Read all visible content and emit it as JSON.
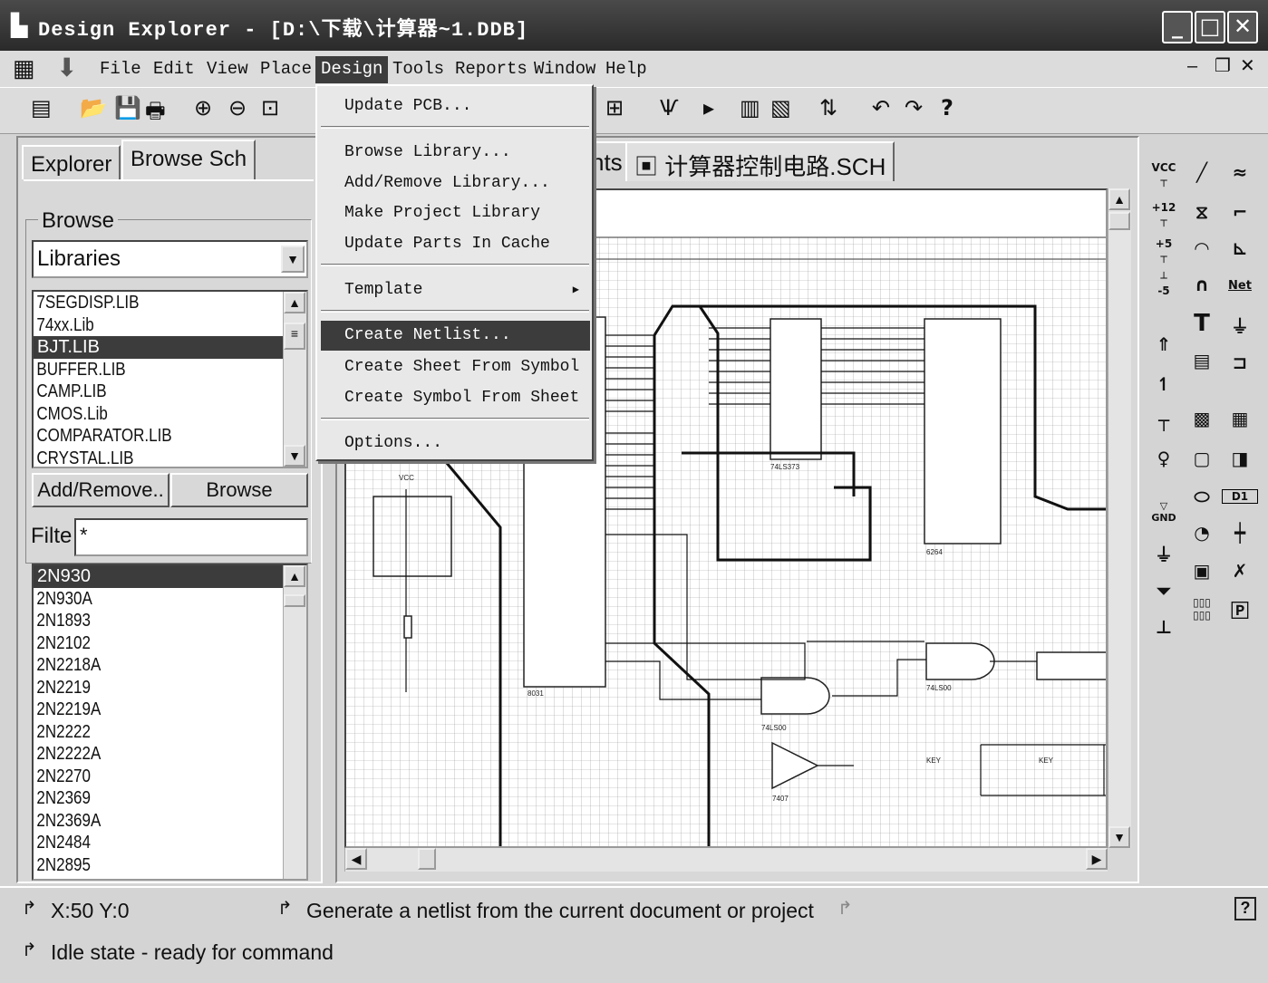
{
  "window": {
    "title": "Design Explorer - [D:\\下载\\计算器~1.DDB]",
    "minimize": "_",
    "maximize": "□",
    "close": "✕"
  },
  "menu": [
    "File",
    "Edit",
    "View",
    "Place",
    "Design",
    "Tools",
    "Reports",
    "Window",
    "Help"
  ],
  "design_menu": {
    "items": [
      "Update PCB...",
      "Browse Library...",
      "Add/Remove Library...",
      "Make Project Library",
      "Update Parts In Cache",
      "Template",
      "Create Netlist...",
      "Create Sheet From Symbol",
      "Create Symbol From Sheet",
      "Options..."
    ],
    "highlighted": "Create Netlist..."
  },
  "left_panel": {
    "tabs": [
      "Explorer",
      "Browse Sch"
    ],
    "active_tab": "Browse Sch",
    "browse_label": "Browse",
    "browse_select": "Libraries",
    "libraries": [
      "7SEGDISP.LIB",
      "74xx.Lib",
      "BJT.LIB",
      "BUFFER.LIB",
      "CAMP.LIB",
      "CMOS.Lib",
      "COMPARATOR.LIB",
      "CRYSTAL.LIB"
    ],
    "selected_library": "BJT.LIB",
    "add_remove_button": "Add/Remove..",
    "browse_button": "Browse",
    "filter_label": "Filte",
    "filter_value": "*",
    "parts": [
      "2N930",
      "2N930A",
      "2N1893",
      "2N2102",
      "2N2218A",
      "2N2219",
      "2N2219A",
      "2N2222",
      "2N2222A",
      "2N2270",
      "2N2369",
      "2N2369A",
      "2N2484",
      "2N2895"
    ],
    "selected_part": "2N930"
  },
  "doc_tabs": [
    "nts",
    "计算器控制电路.SCH"
  ],
  "schematic": {
    "labels": [
      "8031",
      "74LS373",
      "6264",
      "74LS00",
      "74LS00",
      "7407",
      "VCC",
      "KEY",
      "KEY"
    ]
  },
  "palette": {
    "labels": [
      "VCC",
      "+12",
      "+5",
      "-5",
      "Net",
      "T",
      "GND",
      "D1"
    ]
  },
  "status": {
    "coords": "X:50 Y:0",
    "message": "Generate a netlist from the current document or project",
    "state": "Idle state - ready for command",
    "help": "?"
  },
  "colors": {
    "highlight": "#3c3c3c",
    "background": "#d8d8d8"
  }
}
